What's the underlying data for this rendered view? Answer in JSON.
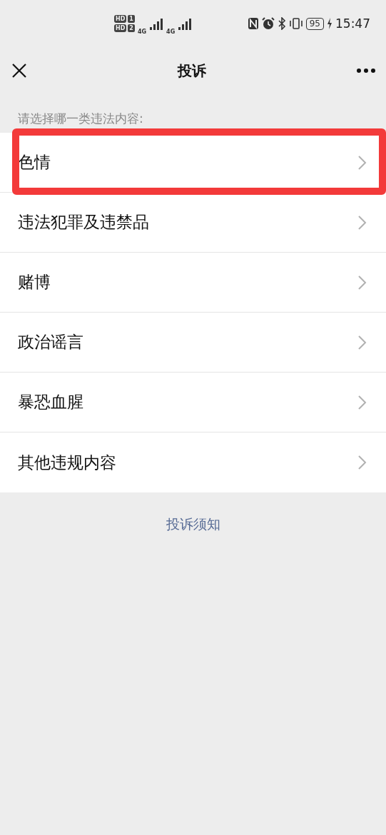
{
  "status_bar": {
    "sims": [
      {
        "badge": "HD",
        "slot": "1",
        "network": "4G"
      },
      {
        "badge": "HD",
        "slot": "2",
        "network": "4G"
      }
    ],
    "battery": "95",
    "time": "15:47"
  },
  "nav": {
    "title": "投诉"
  },
  "prompt": "请选择哪一类违法内容:",
  "categories": [
    {
      "label": "色情",
      "highlighted": true
    },
    {
      "label": "违法犯罪及违禁品",
      "highlighted": false
    },
    {
      "label": "赌博",
      "highlighted": false
    },
    {
      "label": "政治谣言",
      "highlighted": false
    },
    {
      "label": "暴恐血腥",
      "highlighted": false
    },
    {
      "label": "其他违规内容",
      "highlighted": false
    }
  ],
  "footer_link": "投诉须知"
}
